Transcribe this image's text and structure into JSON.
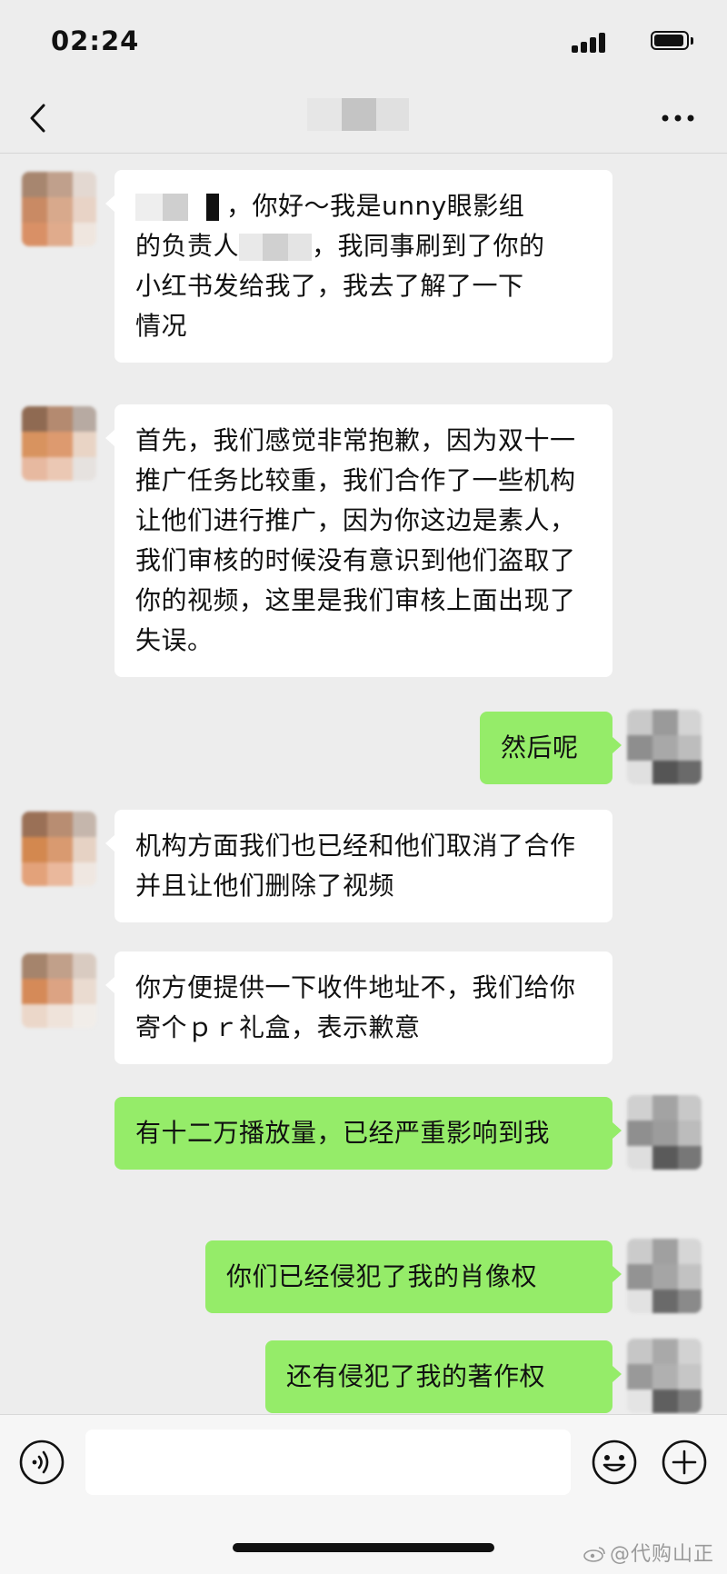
{
  "status_bar": {
    "time": "02:24"
  },
  "header": {
    "title": "",
    "back_icon": "chevron-left-icon",
    "more_icon": "more-dots-icon"
  },
  "messages": [
    {
      "side": "in",
      "text": "，你好～我是unny眼影组的负责人，我同事刷到了你的小红书发给我了，我去了解了一下情况"
    },
    {
      "side": "in",
      "text": "首先，我们感觉非常抱歉，因为双十一推广任务比较重，我们合作了一些机构让他们进行推广，因为你这边是素人，我们审核的时候没有意识到他们盗取了你的视频，这里是我们审核上面出现了失误。"
    },
    {
      "side": "out",
      "text": "然后呢"
    },
    {
      "side": "in",
      "text": "机构方面我们也已经和他们取消了合作并且让他们删除了视频"
    },
    {
      "side": "in",
      "text": "你方便提供一下收件地址不，我们给你寄个ｐｒ礼盒，表示歉意"
    },
    {
      "side": "out",
      "text": "有十二万播放量，已经严重影响到我"
    },
    {
      "side": "out",
      "text": "你们已经侵犯了我的肖像权"
    },
    {
      "side": "out",
      "text": "还有侵犯了我的著作权"
    }
  ],
  "message_parts": {
    "m1a": "，你好～我是unny眼影组",
    "m1b": "的负责人",
    "m1c": "，我同事刷到了你的",
    "m1d": "小红书发给我了，我去了解了一下",
    "m1e": "情况"
  },
  "input_bar": {
    "voice_icon": "voice-icon",
    "emoji_icon": "emoji-icon",
    "plus_icon": "plus-icon",
    "input_value": ""
  },
  "watermark": {
    "text": "@代购山正"
  },
  "colors": {
    "background": "#ededed",
    "bubble_in": "#ffffff",
    "bubble_out": "#95ec69",
    "text": "#111111"
  }
}
